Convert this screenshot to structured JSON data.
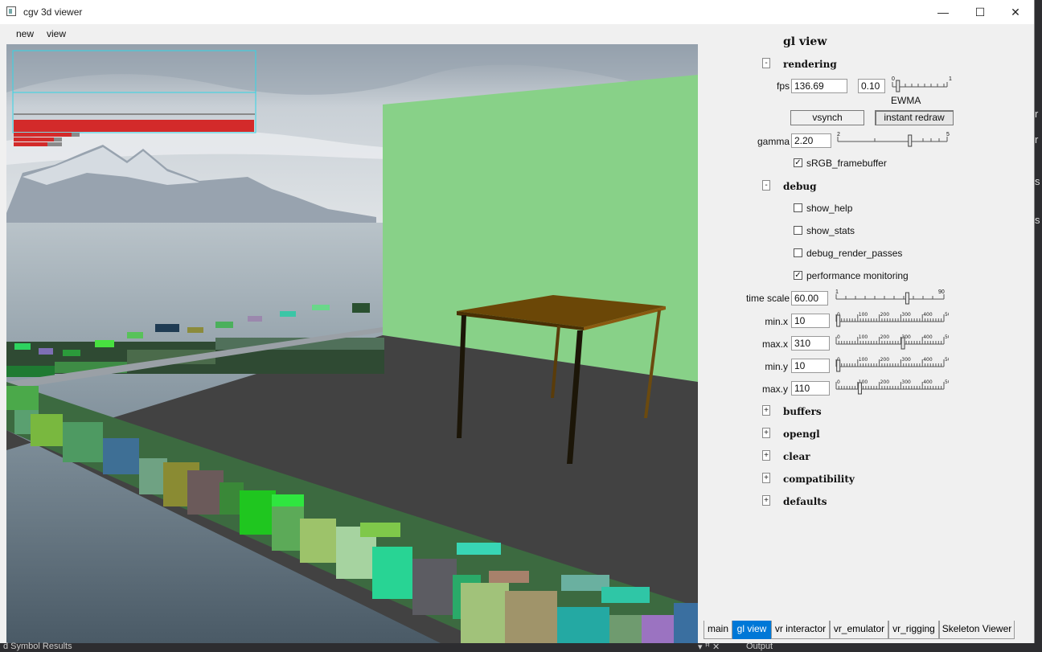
{
  "window": {
    "title": "cgv 3d viewer",
    "minimize": "—",
    "maximize": "☐",
    "close": "✕"
  },
  "menu": {
    "items": [
      "new",
      "view"
    ]
  },
  "panel": {
    "title": "gl view",
    "rendering": {
      "header": "rendering",
      "toggle": "-",
      "fps_label": "fps",
      "fps_value": "136.69",
      "ewma_value": "0.10",
      "ewma_label": "EWMA",
      "ewma_slider": {
        "min": "0",
        "max": "1",
        "value": 0.1
      },
      "vsynch": "vsynch",
      "instant_redraw": "instant redraw",
      "gamma_label": "gamma",
      "gamma_value": "2.20",
      "gamma_slider": {
        "min": "2",
        "max": "5",
        "value": 0.66
      },
      "srgb_label": "sRGB_framebuffer",
      "srgb_checked": "✓"
    },
    "debug": {
      "header": "debug",
      "toggle": "-",
      "show_help": "show_help",
      "show_stats": "show_stats",
      "debug_render_passes": "debug_render_passes",
      "performance_monitoring": "performance monitoring",
      "perf_checked": "✓"
    },
    "timing": {
      "time_scale_label": "time scale",
      "time_scale_value": "60.00",
      "time_scale_slider": {
        "min": "1",
        "max": "90",
        "value": 0.66
      },
      "min_x_label": "min.x",
      "min_x_value": "10",
      "max_x_label": "max.x",
      "max_x_value": "310",
      "min_y_label": "min.y",
      "min_y_value": "10",
      "max_y_label": "max.y",
      "max_y_value": "110",
      "range_ticks": [
        "0",
        "100",
        "200",
        "300",
        "400",
        "500"
      ],
      "sliders": {
        "min_x": 0.02,
        "max_x": 0.62,
        "min_y": 0.02,
        "max_y": 0.22
      }
    },
    "groups": [
      {
        "toggle": "+",
        "label": "buffers"
      },
      {
        "toggle": "+",
        "label": "opengl"
      },
      {
        "toggle": "+",
        "label": "clear"
      },
      {
        "toggle": "+",
        "label": "compatibility"
      },
      {
        "toggle": "+",
        "label": "defaults"
      }
    ]
  },
  "tabs": [
    "main",
    "gl view",
    "vr interactor",
    "vr_emulator",
    "vr_rigging",
    "Skeleton Viewer"
  ],
  "bottom": {
    "left": "d Symbol Results",
    "right": "Output",
    "pin": "▾ ꟸ ✕"
  },
  "colors": {
    "active_tab": "#0078d7",
    "green_wall": "#88d188",
    "floor": "#424242",
    "table": "#6b4707",
    "perf_bar": "#d32a2a",
    "perf_frame": "#33d6e6"
  }
}
